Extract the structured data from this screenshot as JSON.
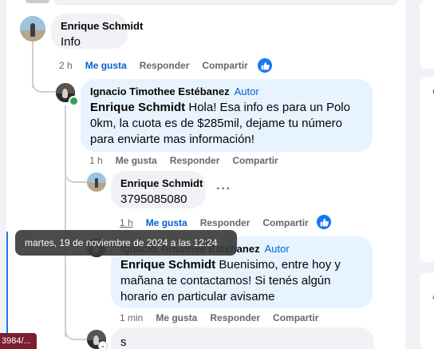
{
  "comments": [
    {
      "author": "Enrique Schmidt",
      "text": "Info",
      "time": "2 h",
      "like": "Me gusta",
      "reply": "Responder",
      "share": "Compartir"
    },
    {
      "author": "Ignacio Timothee Estébanez",
      "author_badge": "Autor",
      "mention": "Enrique Schmidt",
      "text": " Hola! Esa info es para un Polo 0km, la cuota es de $285mil, dejame tu número para enviarte mas información!",
      "time": "1 h",
      "like": "Me gusta",
      "reply": "Responder",
      "share": "Compartir"
    },
    {
      "author": "Enrique Schmidt",
      "text": "3795085080",
      "time": "1 h",
      "like": "Me gusta",
      "reply": "Responder",
      "share": "Compartir",
      "more": "···"
    },
    {
      "author": "Ignacio Timothee Estébanez",
      "author_badge": "Autor",
      "mention": "Enrique Schmidt",
      "text": " Buenisimo, entre hoy y mañana te contactamos! Si tenés algún horario en particular avisame",
      "time": "1 min",
      "like": "Me gusta",
      "reply": "Responder",
      "share": "Compartir"
    }
  ],
  "tooltip": "martes, 19 de noviembre de 2024 a las 12:24",
  "reply_input_value": "s",
  "status_url": "3984/...",
  "right_cards": [
    {
      "edge_text": "C"
    },
    {
      "edge_text": "A"
    }
  ],
  "colors": {
    "like_blue": "#1877f2",
    "author_blue": "#0064d1",
    "bubble_gray": "#f0f2f5",
    "bubble_blue": "#e7f3ff"
  },
  "icons": [
    "like-icon",
    "more-options-icon",
    "chevron-down-icon"
  ]
}
